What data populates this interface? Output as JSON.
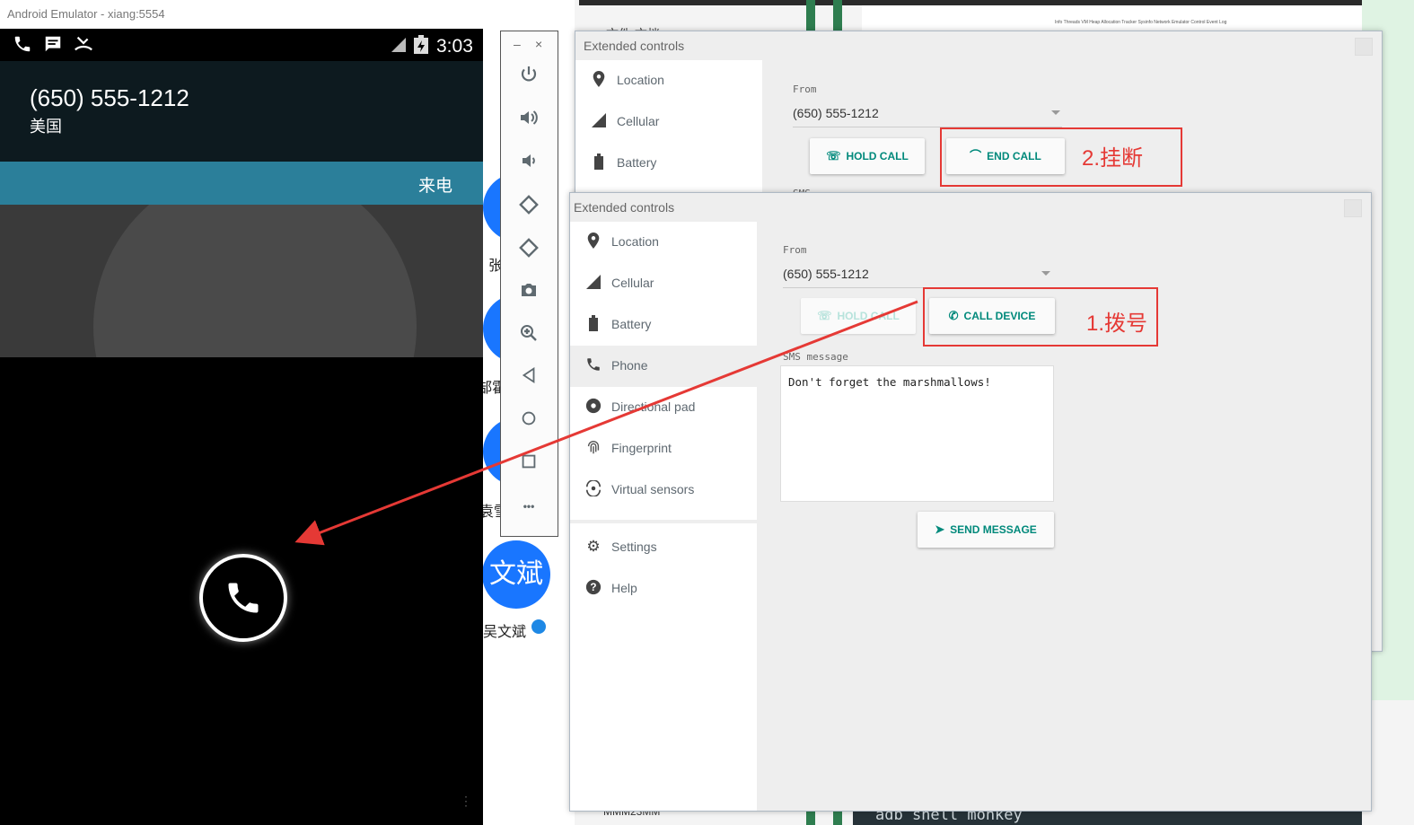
{
  "background": {
    "left_text": "文件    文档",
    "thumb_text": "Info  Threads  VM Heap  Allocation Tracker  Sysinfo  Network  Emulator Control  Event Log",
    "terminal_text": "adb shell monkey",
    "bottom_text": "MMM23MM"
  },
  "emulator": {
    "window_title": "Android Emulator - xiang:5554",
    "status_time": "3:03",
    "caller_number": "(650) 555-1212",
    "caller_location": "美国",
    "incoming_label": "来电",
    "answer_icon": "phone-icon"
  },
  "toolbar": {
    "minimize_label": "–",
    "close_label": "×",
    "buttons": [
      "power-icon",
      "volume-up-icon",
      "volume-down-icon",
      "rotate-left-icon",
      "rotate-right-icon",
      "camera-icon",
      "zoom-icon",
      "back-icon",
      "home-icon",
      "overview-icon",
      "more-icon"
    ],
    "more_label": "•••"
  },
  "contacts": {
    "bubble1": "张",
    "name1": "张",
    "bubble2": "霍",
    "name2": "郜霍",
    "bubble3": "袁",
    "name3": "袁雪",
    "bubble4": "文斌",
    "name4": "吴文斌"
  },
  "ext_back": {
    "title": "Extended controls",
    "nav": [
      {
        "label": "Location",
        "icon": "location-pin-icon"
      },
      {
        "label": "Cellular",
        "icon": "cellular-signal-icon"
      },
      {
        "label": "Battery",
        "icon": "battery-icon"
      }
    ],
    "from_label": "From",
    "from_value": "(650) 555-1212",
    "hold_call": "HOLD CALL",
    "end_call": "END CALL",
    "annotation": "2.挂断",
    "sms_label_partial": "SMS"
  },
  "ext_front": {
    "title": "Extended controls",
    "nav": [
      {
        "label": "Location",
        "icon": "location-pin-icon"
      },
      {
        "label": "Cellular",
        "icon": "cellular-signal-icon"
      },
      {
        "label": "Battery",
        "icon": "battery-icon"
      },
      {
        "label": "Phone",
        "icon": "phone-icon"
      },
      {
        "label": "Directional pad",
        "icon": "dpad-icon"
      },
      {
        "label": "Fingerprint",
        "icon": "fingerprint-icon"
      },
      {
        "label": "Virtual sensors",
        "icon": "virtual-sensors-icon"
      }
    ],
    "nav2": [
      {
        "label": "Settings",
        "icon": "gear-icon"
      },
      {
        "label": "Help",
        "icon": "help-icon"
      }
    ],
    "from_label": "From",
    "from_value": "(650) 555-1212",
    "hold_call": "HOLD CALL",
    "call_device": "CALL DEVICE",
    "annotation": "1.拨号",
    "sms_label": "SMS message",
    "sms_value": "Don't forget the marshmallows!",
    "send_message": "SEND MESSAGE"
  },
  "colors": {
    "accent_teal": "#00897b",
    "annotation_red": "#e53935",
    "incoming_bar": "#2b7f9a",
    "contact_blue": "#1976ff"
  }
}
